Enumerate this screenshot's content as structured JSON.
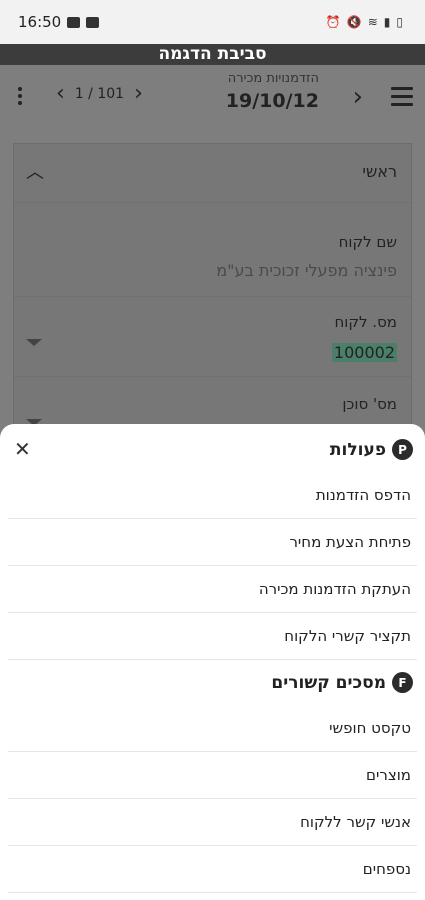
{
  "status_bar": {
    "time": "16:50"
  },
  "env_banner": "סביבת הדגמה",
  "header": {
    "subtitle": "הזדמנויות מכירה",
    "title": "19/10/12",
    "pager": "1 / 101"
  },
  "form": {
    "section_label": "ראשי",
    "fields": [
      {
        "label": "שם לקוח",
        "value": "פינציה מפעלי זכוכית בע\"מ"
      },
      {
        "label": "מס. לקוח",
        "value": "100002"
      },
      {
        "label": "מס' סוכן",
        "value": ""
      }
    ]
  },
  "sheet": {
    "actions_group": {
      "badge": "P",
      "title": "פעולות"
    },
    "actions": [
      "הדפס הזדמנות",
      "פתיחת הצעת מחיר",
      "העתקת הזדמנות מכירה",
      "תקציר קשרי הלקוח"
    ],
    "related_group": {
      "badge": "F",
      "title": "מסכים קשורים"
    },
    "related": [
      "טקסט חופשי",
      "מוצרים",
      "אנשי קשר ללקוח",
      "נספחים"
    ]
  }
}
